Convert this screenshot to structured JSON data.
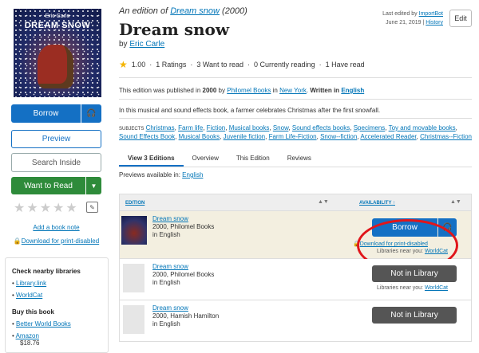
{
  "cover": {
    "author_text": "Eric Carle",
    "title_text": "DREAM SNOW"
  },
  "left": {
    "borrow": "Borrow",
    "preview": "Preview",
    "search_inside": "Search Inside",
    "want_to_read": "Want to Read",
    "rating_value": 0,
    "add_note": "Add a book note",
    "download": "Download for print-disabled"
  },
  "libraries": {
    "check_heading": "Check nearby libraries",
    "check_items": [
      "Library.link",
      "WorldCat"
    ],
    "buy_heading": "Buy this book",
    "buy_items": [
      "Better World Books",
      "Amazon"
    ],
    "amazon_price": "$18.76"
  },
  "header": {
    "edition_prefix": "An edition of",
    "work_link": "Dream snow",
    "year": "(2000)",
    "title": "Dream snow",
    "by": "by",
    "author": "Eric Carle",
    "last_edited_label": "Last edited by",
    "last_edited_by": "ImportBot",
    "last_edited_date": "June 21, 2019",
    "history": "History",
    "edit": "Edit"
  },
  "stats": {
    "avg": "1.00",
    "ratings": "1 Ratings",
    "want": "3 Want to read",
    "reading": "0 Currently reading",
    "have_read": "1 Have read"
  },
  "publication": {
    "prefix": "This edition was published in",
    "year": "2000",
    "by_word": "by",
    "publisher": "Philomel Books",
    "in_word": "in",
    "place": "New York",
    "written_in": "Written in",
    "language": "English"
  },
  "description": "In this musical and sound effects book, a farmer celebrates Christmas after the first snowfall.",
  "subjects": {
    "label": "Subjects",
    "items": [
      "Christmas",
      "Farm life",
      "Fiction",
      "Musical books",
      "Snow",
      "Sound effects books",
      "Specimens",
      "Toy and movable books",
      "Sound Effects Book",
      "Musical Books",
      "Juvenile fiction",
      "Farm Life-Fiction",
      "Snow--fiction",
      "Accelerated Reader",
      "Christmas--Fiction"
    ]
  },
  "tabs": [
    "View 3 Editions",
    "Overview",
    "This Edition",
    "Reviews"
  ],
  "previews": {
    "label": "Previews available in:",
    "language": "English"
  },
  "table": {
    "col_edition": "EDITION",
    "col_availability": "AVAILABILITY ↑",
    "rows": [
      {
        "title": "Dream snow",
        "line1": "2000, Philomel Books",
        "line2": "in English",
        "action": "Borrow",
        "download": "Download for print-disabled",
        "libs_label": "Libraries near you:",
        "libs_link": "WorldCat"
      },
      {
        "title": "Dream snow",
        "line1": "2000, Philomel Books",
        "line2": "in English",
        "action": "Not in Library",
        "libs_label": "Libraries near you:",
        "libs_link": "WorldCat"
      },
      {
        "title": "Dream snow",
        "line1": "2000, Hamish Hamilton",
        "line2": "in English",
        "action": "Not in Library"
      }
    ]
  },
  "colors": {
    "primary": "#1470c4",
    "green": "#2e8b3a",
    "highlight": "#e0161b",
    "star": "#f4b400"
  }
}
